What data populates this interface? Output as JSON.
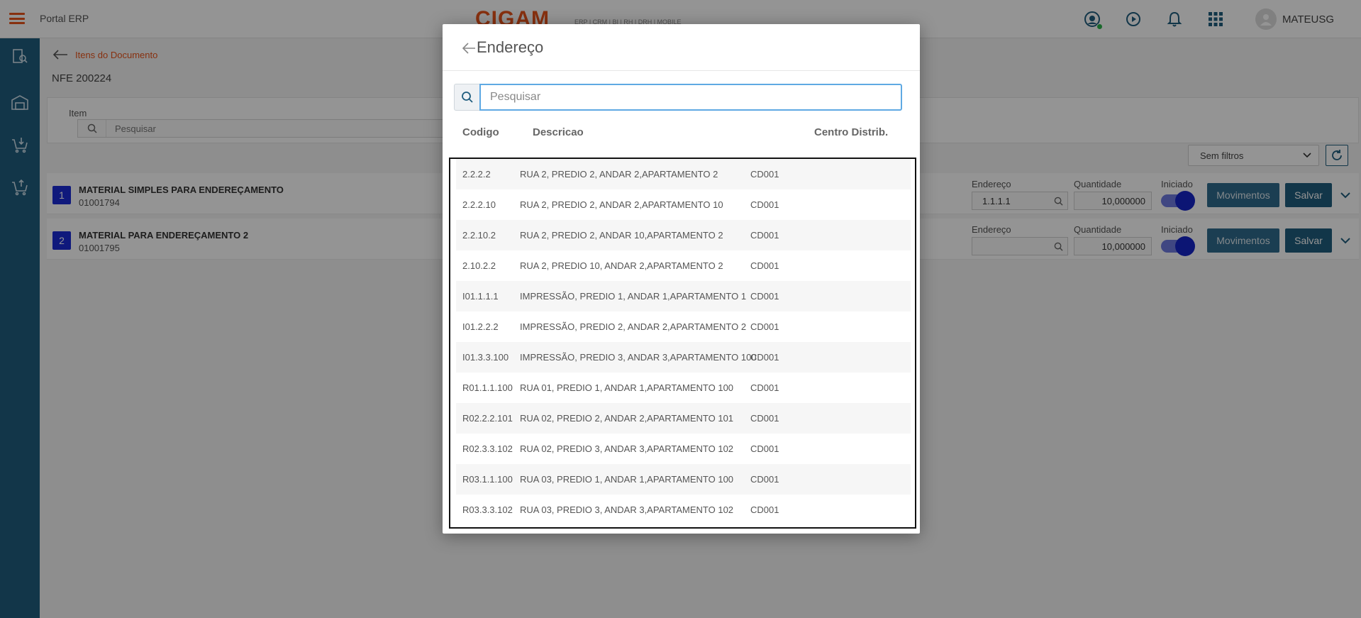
{
  "app": {
    "title": "Portal ERP",
    "logo": "CIGAM",
    "logo_sub": "ERP | CRM | BI | RH | DRH | MOBILE",
    "user": "MATEUSG",
    "brand_color": "#e8541b",
    "sidebar_color": "#1f5d7e"
  },
  "page": {
    "breadcrumb": "Itens do Documento",
    "doc_title": "NFE 200224",
    "filter_label": "Item",
    "filter_placeholder": "Pesquisar",
    "sem_filtros": "Sem filtros"
  },
  "items": [
    {
      "num": "1",
      "name": "MATERIAL SIMPLES PARA ENDEREÇAMENTO",
      "code": "01001794",
      "endereco_label": "Endereço",
      "endereco_value": "1.1.1.1",
      "quantidade_label": "Quantidade",
      "quantidade_value": "10,000000",
      "iniciado_label": "Iniciado",
      "movimentos": "Movimentos",
      "salvar": "Salvar"
    },
    {
      "num": "2",
      "name": "MATERIAL PARA ENDEREÇAMENTO 2",
      "code": "01001795",
      "endereco_label": "Endereço",
      "endereco_value": "",
      "quantidade_label": "Quantidade",
      "quantidade_value": "10,000000",
      "iniciado_label": "Iniciado",
      "movimentos": "Movimentos",
      "salvar": "Salvar"
    }
  ],
  "modal": {
    "title": "Endereço",
    "search_placeholder": "Pesquisar",
    "columns": {
      "codigo": "Codigo",
      "descricao": "Descricao",
      "centro": "Centro Distrib."
    },
    "rows": [
      {
        "codigo": "2.2.2.2",
        "descricao": "RUA 2, PREDIO 2, ANDAR 2,APARTAMENTO 2",
        "centro": "CD001"
      },
      {
        "codigo": "2.2.2.10",
        "descricao": "RUA 2, PREDIO 2, ANDAR 2,APARTAMENTO 10",
        "centro": "CD001"
      },
      {
        "codigo": "2.2.10.2",
        "descricao": "RUA 2, PREDIO 2, ANDAR 10,APARTAMENTO 2",
        "centro": "CD001"
      },
      {
        "codigo": "2.10.2.2",
        "descricao": "RUA 2, PREDIO 10, ANDAR 2,APARTAMENTO 2",
        "centro": "CD001"
      },
      {
        "codigo": "I01.1.1.1",
        "descricao": "IMPRESSÃO, PREDIO 1, ANDAR 1,APARTAMENTO 1",
        "centro": "CD001"
      },
      {
        "codigo": "I01.2.2.2",
        "descricao": "IMPRESSÃO, PREDIO 2, ANDAR 2,APARTAMENTO 2",
        "centro": "CD001"
      },
      {
        "codigo": "I01.3.3.100",
        "descricao": "IMPRESSÃO, PREDIO 3, ANDAR 3,APARTAMENTO 100",
        "centro": "CD001"
      },
      {
        "codigo": "R01.1.1.100",
        "descricao": "RUA 01, PREDIO 1, ANDAR 1,APARTAMENTO 100",
        "centro": "CD001"
      },
      {
        "codigo": "R02.2.2.101",
        "descricao": "RUA 02, PREDIO 2, ANDAR 2,APARTAMENTO 101",
        "centro": "CD001"
      },
      {
        "codigo": "R02.3.3.102",
        "descricao": "RUA 02, PREDIO 3, ANDAR 3,APARTAMENTO 102",
        "centro": "CD001"
      },
      {
        "codigo": "R03.1.1.100",
        "descricao": "RUA 03, PREDIO 1, ANDAR 1,APARTAMENTO 100",
        "centro": "CD001"
      },
      {
        "codigo": "R03.3.3.102",
        "descricao": "RUA 03, PREDIO 3, ANDAR 3,APARTAMENTO 102",
        "centro": "CD001"
      }
    ]
  }
}
